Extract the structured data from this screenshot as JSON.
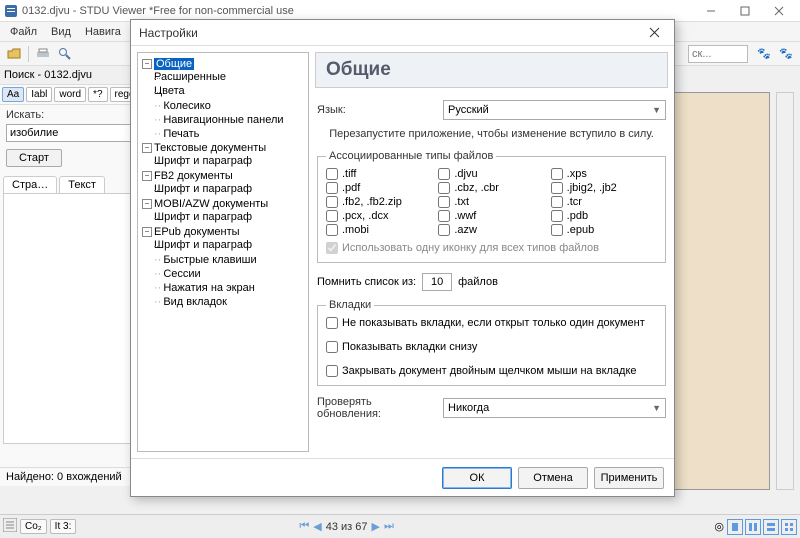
{
  "window": {
    "title": "0132.djvu - STDU Viewer *Free for non-commercial use"
  },
  "menu": {
    "file": "Файл",
    "view": "Вид",
    "nav": "Навига"
  },
  "toolbar": {
    "right_placeholder": "ск..."
  },
  "search": {
    "title": "Поиск - 0132.djvu",
    "opts": [
      "Aa",
      "Iabl",
      "word",
      "*?",
      "regex"
    ],
    "label_search": "Искать:",
    "query": "изобилие",
    "start_btn": "Старт",
    "tab_pages": "Стра…",
    "tab_text": "Текст",
    "status": "Найдено: 0 вхождений"
  },
  "bottombar": {
    "badge1": "Co₂",
    "badge2": "It 3:",
    "page_info": "43 из 67"
  },
  "dialog": {
    "title": "Настройки",
    "tree": {
      "general": "Общие",
      "general_ext": "Расширенные",
      "general_colors": "Цвета",
      "wheel": "Колесико",
      "nav_panels": "Навигационные панели",
      "print": "Печать",
      "text_docs": "Текстовые документы",
      "font_para": "Шрифт и параграф",
      "fb2_docs": "FB2 документы",
      "mobi_docs": "MOBI/AZW документы",
      "epub_docs": "EPub документы",
      "hotkeys": "Быстрые клавиши",
      "sessions": "Сессии",
      "screen_tap": "Нажатия на экран",
      "tabs_view": "Вид вкладок"
    },
    "right": {
      "heading": "Общие",
      "lang_label": "Язык:",
      "lang_value": "Русский",
      "restart_hint": "Перезапустите приложение, чтобы изменение вступило в силу.",
      "assoc_legend": "Ассоциированные типы файлов",
      "filetypes": {
        "c1r1": ".tiff",
        "c2r1": ".djvu",
        "c3r1": ".xps",
        "c1r2": ".pdf",
        "c2r2": ".cbz, .cbr",
        "c3r2": ".jbig2, .jb2",
        "c1r3": ".fb2, .fb2.zip",
        "c2r3": ".txt",
        "c3r3": ".tcr",
        "c1r4": ".pcx, .dcx",
        "c2r4": ".wwf",
        "c3r4": ".pdb",
        "c1r5": ".mobi",
        "c2r5": ".azw",
        "c3r5": ".epub"
      },
      "one_icon": "Использовать одну иконку для всех типов файлов",
      "remember_label_pre": "Помнить список из:",
      "remember_value": "10",
      "remember_label_post": "файлов",
      "tabs_legend": "Вкладки",
      "tabs_opt1": "Не показывать вкладки, если открыт только один документ",
      "tabs_opt2": "Показывать вкладки снизу",
      "tabs_opt3": "Закрывать документ двойным щелчком мыши на вкладке",
      "updates_label": "Проверять обновления:",
      "updates_value": "Никогда",
      "btn_ok": "ОК",
      "btn_cancel": "Отмена",
      "btn_apply": "Применить"
    }
  }
}
